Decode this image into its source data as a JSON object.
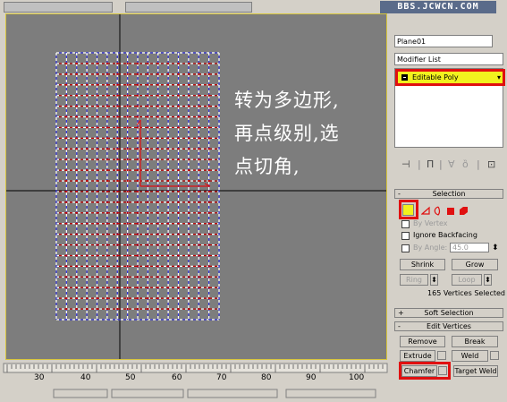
{
  "watermark": "BBS.JCWCN.COM",
  "object_name": "Plane01",
  "modifier_list_label": "Modifier List",
  "modifier_stack": {
    "item_label": "Editable Poly"
  },
  "caption_lines": [
    "转为多边形,",
    "再点级别,选",
    "点切角,"
  ],
  "toolbar_icons": [
    "pin-stack-icon",
    "show-end-result-icon",
    "make-unique-icon",
    "remove-modifier-icon",
    "configure-sets-icon"
  ],
  "selection": {
    "header": "Selection",
    "subobject_icons": [
      "vertex-icon",
      "edge-icon",
      "border-icon",
      "polygon-icon",
      "element-icon"
    ],
    "by_vertex": "By Vertex",
    "ignore_backfacing": "Ignore Backfacing",
    "by_angle": "By Angle:",
    "by_angle_value": "45.0",
    "shrink": "Shrink",
    "grow": "Grow",
    "ring": "Ring",
    "loop": "Loop",
    "status": "165 Vertices Selected"
  },
  "soft_selection": {
    "header": "Soft Selection"
  },
  "edit_vertices": {
    "header": "Edit Vertices",
    "remove": "Remove",
    "break": "Break",
    "extrude": "Extrude",
    "weld": "Weld",
    "chamfer": "Chamfer",
    "target_weld": "Target Weld"
  },
  "ruler": {
    "labels": [
      "30",
      "40",
      "50",
      "60",
      "70",
      "80",
      "90",
      "100"
    ]
  },
  "colors": {
    "viewport_bg": "#7d7d7d",
    "grid_wire": "#ffffff",
    "selected_vertex": "#c00000",
    "unselected_edge": "#3a3ae0",
    "highlight_box": "#e01010",
    "active_stack_item": "#f2f21e"
  }
}
